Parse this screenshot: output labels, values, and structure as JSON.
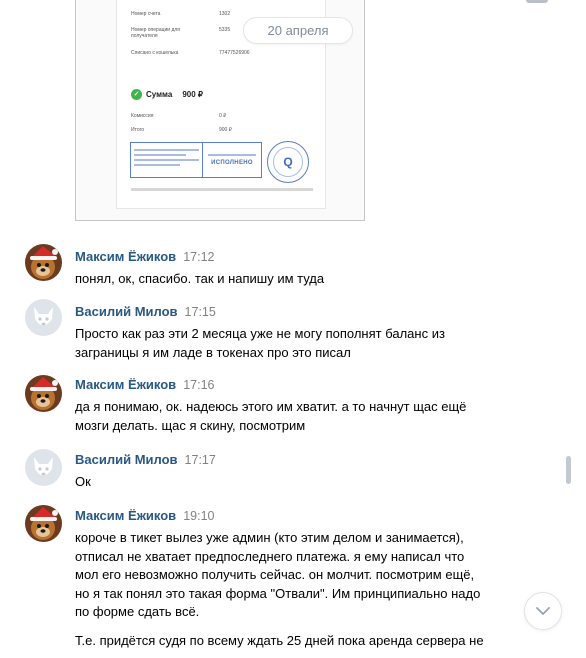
{
  "date_divider": "20 апреля",
  "receipt": {
    "rows": [
      {
        "label": "Номер счета",
        "value": "1302"
      },
      {
        "label": "Номер операции для получателя",
        "value": "5335"
      },
      {
        "label": "Списано с кошелька",
        "value": "77477526906"
      }
    ],
    "sum_label": "Сумма",
    "sum_value": "900 ₽",
    "fee_label": "Комиссия",
    "fee_value": "0 ₽",
    "total_label": "Итого",
    "total_value": "900 ₽",
    "stamp_text": "ИСПОЛНЕНО",
    "seal_text": "Q"
  },
  "messages": [
    {
      "author": "Максим Ёжиков",
      "time": "17:12",
      "avatar": "santa-dog-avatar",
      "lines": [
        "понял, ок, спасибо. так и напишу им туда"
      ]
    },
    {
      "author": "Василий Милов",
      "time": "17:15",
      "avatar": "default-dog-avatar",
      "lines": [
        "Просто как раз эти 2 месяца уже не могу пополнят баланс из",
        "заграницы я им ладе в токенах про это писал"
      ]
    },
    {
      "author": "Максим Ёжиков",
      "time": "17:16",
      "avatar": "santa-dog-avatar",
      "lines": [
        "да я понимаю, ок. надеюсь этого им хватит. а то начнут щас ещё",
        "мозги делать. щас я скину, посмотрим"
      ]
    },
    {
      "author": "Василий Милов",
      "time": "17:17",
      "avatar": "default-dog-avatar",
      "lines": [
        "Ок"
      ]
    },
    {
      "author": "Максим Ёжиков",
      "time": "19:10",
      "avatar": "santa-dog-avatar",
      "lines": [
        "короче в тикет вылез уже админ (кто этим делом и занимается),",
        "отписал не хватает предпоследнего платежа. я ему написал что",
        "мол его невозможно получить сейчас. он молчит. посмотрим ещё,",
        "но я так понял это такая форма \"Отвали\". Им принципиально надо",
        "по форме сдать всё.",
        "",
        "Т.е. придётся судя по всему ждать 25 дней пока аренда сервера не"
      ]
    }
  ],
  "colors": {
    "author": "#2a5885",
    "time": "#828282",
    "accent": "#5181b8"
  }
}
